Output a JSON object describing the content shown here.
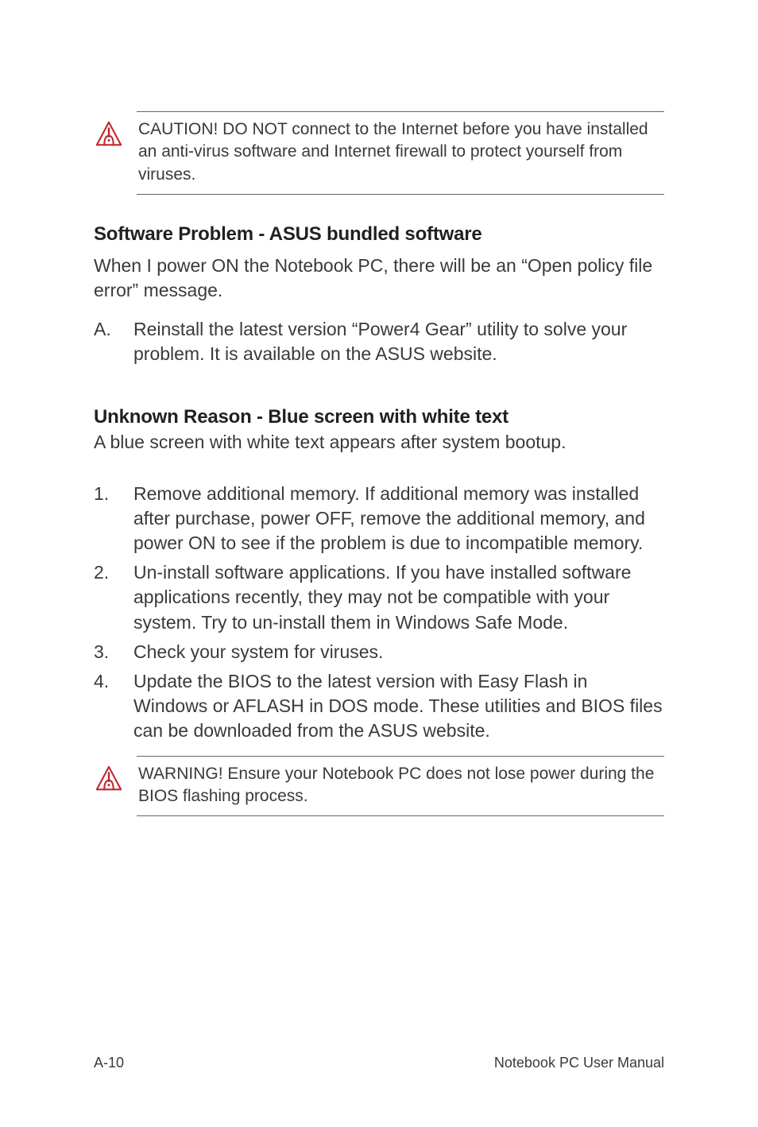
{
  "caution_top": {
    "text": "CAUTION! DO NOT connect to the Internet before you have installed an anti-virus software and Internet firewall to protect yourself from viruses."
  },
  "section1": {
    "heading": "Software Problem - ASUS bundled software",
    "intro": "When I power ON the Notebook PC, there will be an “Open policy file error” message.",
    "items": [
      {
        "marker": "A.",
        "text": "Reinstall the latest version “Power4 Gear” utility to solve your problem. It is available on the ASUS website."
      }
    ]
  },
  "section2": {
    "heading": "Unknown Reason - Blue screen with white text",
    "intro": "A blue screen with white text appears after system bootup.",
    "items": [
      {
        "marker": "1.",
        "text": "Remove additional memory. If additional memory was installed after purchase, power OFF, remove the additional memory, and power ON to see if the problem is due to incompatible memory."
      },
      {
        "marker": "2.",
        "text": "Un-install software applications. If you have installed software applications recently, they may not be compatible with your system. Try to un-install them in Windows Safe Mode."
      },
      {
        "marker": "3.",
        "text": "Check your system for viruses."
      },
      {
        "marker": "4.",
        "text": "Update the BIOS to the latest version with Easy Flash in Windows or AFLASH in DOS mode. These utilities and BIOS files can be downloaded from the ASUS website."
      }
    ]
  },
  "warning_bottom": {
    "text": "WARNING! Ensure your Notebook PC does not lose power during the BIOS flashing process."
  },
  "footer": {
    "page": "A-10",
    "title": "Notebook PC User Manual"
  }
}
